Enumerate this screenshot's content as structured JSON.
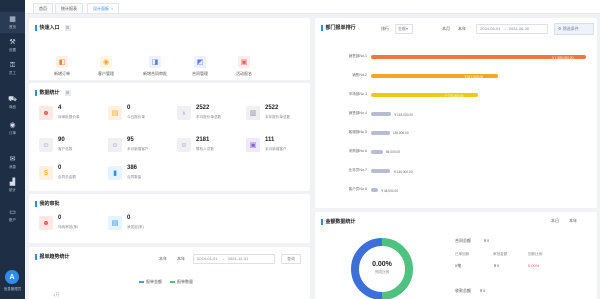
{
  "sidebar": {
    "items": [
      {
        "label": "首页",
        "icon": "grid-icon"
      },
      {
        "label": "设置",
        "icon": "wrench-icon"
      },
      {
        "label": "员工",
        "icon": "key-icon"
      },
      {
        "label": "商品",
        "icon": "cart-icon"
      },
      {
        "label": "订单",
        "icon": "circle-play-icon"
      },
      {
        "label": "消息",
        "icon": "envelope-icon"
      },
      {
        "label": "统计",
        "icon": "chart-icon"
      },
      {
        "label": "账户",
        "icon": "monitor-icon"
      }
    ],
    "avatar_letter": "A",
    "user": "信息管理员"
  },
  "tabs": [
    {
      "label": "首页"
    },
    {
      "label": "统计报表"
    },
    {
      "label": "设计面板",
      "close": "×"
    }
  ],
  "quick_entry": {
    "title": "快速入口",
    "items": [
      {
        "label": "新增订单",
        "color": "#ff7a45"
      },
      {
        "label": "客户管理",
        "color": "#f5a623"
      },
      {
        "label": "新增合同审批",
        "color": "#5b7cf5"
      },
      {
        "label": "合同管理",
        "color": "#5b7cf5"
      },
      {
        "label": "活动报名",
        "color": "#f05c5c"
      }
    ]
  },
  "data_stats": {
    "title": "数据统计",
    "items": [
      {
        "value": "4",
        "label": "待审批报价单"
      },
      {
        "value": "0",
        "label": "今日报价单"
      },
      {
        "value": "2522",
        "label": "本月报价单总数"
      },
      {
        "value": "2522",
        "label": "本年报价单总数"
      },
      {
        "value": "90",
        "label": "客户总数"
      },
      {
        "value": "95",
        "label": "本月新增客户"
      },
      {
        "value": "2181",
        "label": "联系人总数"
      },
      {
        "value": "111",
        "label": "本月新增客户"
      },
      {
        "value": "0",
        "label": "合同总金额"
      },
      {
        "value": "386",
        "label": "合同数量"
      }
    ]
  },
  "my_approval": {
    "title": "我的审批",
    "items": [
      {
        "value": "0",
        "label": "待我审批(条)"
      },
      {
        "value": "0",
        "label": "我发起(条)"
      }
    ]
  },
  "trend": {
    "title": "报单趋势统计",
    "month": "本年",
    "year": "本年",
    "date_from": "2024-01-01",
    "date_to": "2024-12-31",
    "arrow": "→",
    "button": "查询",
    "legend": [
      "报单金额",
      "报单数量"
    ],
    "axis_first_tick": "1万"
  },
  "ranking": {
    "title": "部门报单排行",
    "unit_label": "排行",
    "unit_value": "金额",
    "period_month": "本月",
    "period_year": "本年",
    "date_from": "2024-04-01",
    "date_to": "2024-06-30",
    "arrow": "→",
    "filter": "筛选条件"
  },
  "chart_data": {
    "type": "bar",
    "title": "部门报单排行",
    "orientation": "horizontal",
    "categories": [
      "销售部No.1",
      "销售No.2",
      "市场部No.3",
      "销售部No.4",
      "客服部No.5",
      "采购部No.6",
      "业务员No.7",
      "客户员No.8"
    ],
    "values": [
      1550000,
      917000,
      775000,
      143000,
      135000,
      86000,
      140000,
      48000
    ],
    "labels": [
      "￥1,550,000.00",
      "￥917,000.00",
      "￥775,000.00",
      "￥143,000.00",
      "135,000.00",
      "86,000.00",
      "￥140,000.00",
      "￥48,000.00"
    ],
    "colors": [
      "#f07840",
      "#f5a623",
      "#f5c518",
      "#b6bdd2",
      "#b6bdd2",
      "#b6bdd2",
      "#b6bdd2",
      "#b6bdd2"
    ],
    "xlim": [
      0,
      1560000
    ]
  },
  "fund": {
    "title": "金额数据统计",
    "period_day": "本日",
    "period_year": "本年",
    "percent": "0.00%",
    "center_label": "完成比例",
    "ring_colors": [
      "#3d6fd8",
      "#4ec27f"
    ],
    "total_label": "合同总额",
    "total_value": "￥0",
    "cols": [
      "已审回款",
      "审批金额",
      "回款比例"
    ],
    "row1": [
      "0笔",
      "￥0",
      "0.00%"
    ],
    "paid_label": "收款总额",
    "paid_value": "￥0"
  }
}
